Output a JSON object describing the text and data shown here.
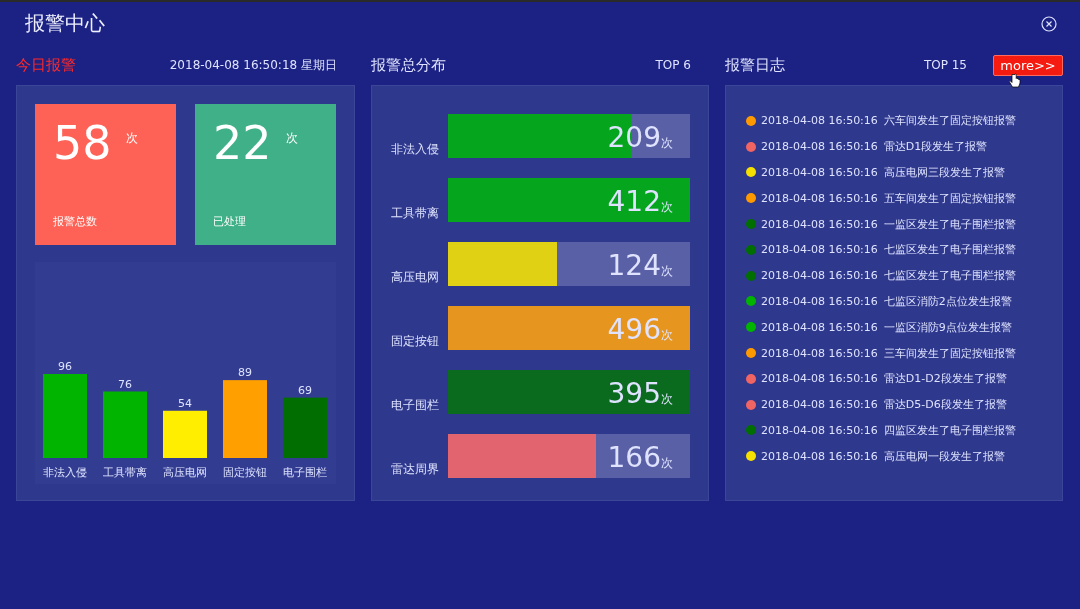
{
  "window": {
    "title": "报警中心"
  },
  "today": {
    "title": "今日报警",
    "datetime": "2018-04-08 16:50:18 星期日",
    "stats": [
      {
        "value": "58",
        "unit": "次",
        "label": "报警总数",
        "color": "#fe6256"
      },
      {
        "value": "22",
        "unit": "次",
        "label": "已处理",
        "color": "#3fb087"
      }
    ],
    "chart_data": {
      "type": "bar",
      "stacked": true,
      "data_labels": true,
      "series": [
        {
          "name": "非法入侵",
          "color": "#00b400",
          "values": [
            96,
            null,
            null,
            null,
            null
          ]
        },
        {
          "name": "工具带离",
          "color": "#00b400",
          "values": [
            null,
            76,
            null,
            null,
            null
          ]
        },
        {
          "name": "高压电网",
          "color": "#ffee00",
          "values": [
            null,
            null,
            54,
            null,
            null
          ]
        },
        {
          "name": "固定按钮",
          "color": "#ffa000",
          "values": [
            null,
            null,
            null,
            89,
            null
          ]
        },
        {
          "name": "电子围栏",
          "color": "#006e00",
          "values": [
            null,
            null,
            null,
            null,
            69
          ]
        }
      ]
    }
  },
  "distribution": {
    "title": "报警总分布",
    "badge": "TOP 6",
    "items": [
      {
        "label": "非法入侵",
        "value": "209",
        "unit": "次",
        "level": 0.76,
        "color": "#05a51e"
      },
      {
        "label": "工具带离",
        "value": "412",
        "unit": "次",
        "level": 1,
        "color": "#05a51e"
      },
      {
        "label": "高压电网",
        "value": "124",
        "unit": "次",
        "level": 0.45,
        "color": "#e1d114"
      },
      {
        "label": "固定按钮",
        "value": "496",
        "unit": "次",
        "level": 1,
        "color": "#e6961e"
      },
      {
        "label": "电子围栏",
        "value": "395",
        "unit": "次",
        "level": 1,
        "color": "#0a6a1e"
      },
      {
        "label": "雷达周界",
        "value": "166",
        "unit": "次",
        "level": 0.61,
        "color": "#e2646e"
      }
    ]
  },
  "log": {
    "title": "报警日志",
    "badge": "TOP 15",
    "more_button": "more>>",
    "entries": [
      {
        "time": "2018-04-08 16:50:16",
        "text": "六车间发生了固定按钮报警",
        "color": "#ff9900"
      },
      {
        "time": "2018-04-08 16:50:16",
        "text": "雷达D1段发生了报警",
        "color": "#f06464"
      },
      {
        "time": "2018-04-08 16:50:16",
        "text": "高压电网三段发生了报警",
        "color": "#f5e000"
      },
      {
        "time": "2018-04-08 16:50:16",
        "text": "五车间发生了固定按钮报警",
        "color": "#ff9900"
      },
      {
        "time": "2018-04-08 16:50:16",
        "text": "一监区发生了电子围栏报警",
        "color": "#006e00"
      },
      {
        "time": "2018-04-08 16:50:16",
        "text": "七监区发生了电子围栏报警",
        "color": "#006e00"
      },
      {
        "time": "2018-04-08 16:50:16",
        "text": "七监区发生了电子围栏报警",
        "color": "#006e00"
      },
      {
        "time": "2018-04-08 16:50:16",
        "text": "七监区消防2点位发生报警",
        "color": "#00b400"
      },
      {
        "time": "2018-04-08 16:50:16",
        "text": "一监区消防9点位发生报警",
        "color": "#00b400"
      },
      {
        "time": "2018-04-08 16:50:16",
        "text": "三车间发生了固定按钮报警",
        "color": "#ff9900"
      },
      {
        "time": "2018-04-08 16:50:16",
        "text": "雷达D1-D2段发生了报警",
        "color": "#f06464"
      },
      {
        "time": "2018-04-08 16:50:16",
        "text": "雷达D5-D6段发生了报警",
        "color": "#f06464"
      },
      {
        "time": "2018-04-08 16:50:16",
        "text": "四监区发生了电子围栏报警",
        "color": "#006e00"
      },
      {
        "time": "2018-04-08 16:50:16",
        "text": "高压电网一段发生了报警",
        "color": "#f5e000"
      }
    ]
  }
}
